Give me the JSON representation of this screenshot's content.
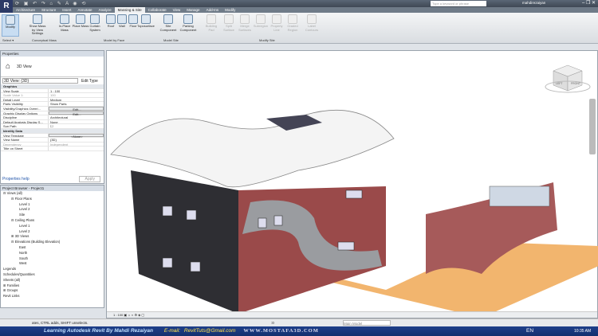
{
  "titlebar": {
    "qat": "⟳ ▣ ↶ ↷ ⌂ ✎ A ◉ ⟲",
    "search_placeholder": "Type a keyword or phrase",
    "user": "mahdirezaiyan",
    "window_controls": "‒ ❐ ✕",
    "app_letter": "R"
  },
  "tabs": [
    "Architecture",
    "Structure",
    "Insert",
    "Annotate",
    "Analyze",
    "Massing & Site",
    "Collaborate",
    "View",
    "Manage",
    "Add-Ins",
    "Modify"
  ],
  "active_tab": "Massing & Site",
  "ribbon": {
    "buttons": [
      "Modify",
      "Show Mass by View Settings",
      "In-Place Mass",
      "Place Mass",
      "Curtain System",
      "Roof",
      "Wall",
      "Floor",
      "Toposurface",
      "Site Component",
      "Parking Component",
      "Building Pad",
      "Split Surface",
      "Merge Surfaces",
      "Subregion",
      "Property Line",
      "Graded Region",
      "Label Contours"
    ],
    "panels": [
      "Select ▾",
      "Conceptual Mass",
      "Model by Face",
      "Model Site",
      "Modify Site"
    ]
  },
  "properties": {
    "title": "Properties",
    "type_name": "3D View",
    "selector": "3D View: {3D}",
    "edit_type": "Edit Type",
    "rows": [
      {
        "k": "Graphics",
        "v": "",
        "group": true
      },
      {
        "k": "View Scale",
        "v": "1 : 100"
      },
      {
        "k": "Scale Value  1:",
        "v": "100",
        "dis": true
      },
      {
        "k": "Detail Level",
        "v": "Medium"
      },
      {
        "k": "Parts Visibility",
        "v": "Show Parts"
      },
      {
        "k": "Visibility/Graphics Overri...",
        "v": "Edit...",
        "btn": true
      },
      {
        "k": "Graphic Display Options",
        "v": "Edit...",
        "btn": true
      },
      {
        "k": "Discipline",
        "v": "Architectural"
      },
      {
        "k": "Default Analysis Display S...",
        "v": "None"
      },
      {
        "k": "Sun Path",
        "v": "☐"
      },
      {
        "k": "Identity Data",
        "v": "",
        "group": true
      },
      {
        "k": "View Template",
        "v": "<None>",
        "btn": true
      },
      {
        "k": "View Name",
        "v": "{3D}"
      },
      {
        "k": "Dependency",
        "v": "Independent",
        "dis": true
      },
      {
        "k": "Title on Sheet",
        "v": ""
      }
    ],
    "help": "Properties help",
    "apply": "Apply"
  },
  "browser": {
    "title": "Project Browser - Project1",
    "items": [
      {
        "t": "⊟ Views (all)",
        "d": 0
      },
      {
        "t": "⊟ Floor Plans",
        "d": 1
      },
      {
        "t": "Level 1",
        "d": 2
      },
      {
        "t": "Level 2",
        "d": 2
      },
      {
        "t": "Site",
        "d": 2
      },
      {
        "t": "⊟ Ceiling Plans",
        "d": 1
      },
      {
        "t": "Level 1",
        "d": 2
      },
      {
        "t": "Level 2",
        "d": 2
      },
      {
        "t": "⊞ 3D Views",
        "d": 1
      },
      {
        "t": "⊟ Elevations (Building Elevation)",
        "d": 1
      },
      {
        "t": "East",
        "d": 2
      },
      {
        "t": "North",
        "d": 2
      },
      {
        "t": "South",
        "d": 2
      },
      {
        "t": "West",
        "d": 2
      },
      {
        "t": "Legends",
        "d": 0
      },
      {
        "t": "Schedules/Quantities",
        "d": 0
      },
      {
        "t": "Sheets (all)",
        "d": 0
      },
      {
        "t": "⊞ Families",
        "d": 0
      },
      {
        "t": "⊞ Groups",
        "d": 0
      },
      {
        "t": "Revit Links",
        "d": 0
      }
    ]
  },
  "viewcube": {
    "left": "LEFT",
    "front": "FRONT"
  },
  "view_bar": {
    "scale": "1 : 100"
  },
  "status": {
    "text": "ates, CTRL adds, SHIFT unselects.",
    "zero": ":0",
    "model": "Main Model"
  },
  "taskbar": {
    "banner": "Learning Autodesk Revit By Mahdi Rezaiyan",
    "email_label": "E-mail:",
    "email": "RevitTuts@Gmail.com",
    "watermark": "WWW.MOSTAFA3D.COM",
    "lang": "EN",
    "clock": "10:35 AM"
  },
  "colors": {
    "ground": "#f2b56e",
    "accent": "#2c3a66",
    "brick": "#a65a5a"
  }
}
